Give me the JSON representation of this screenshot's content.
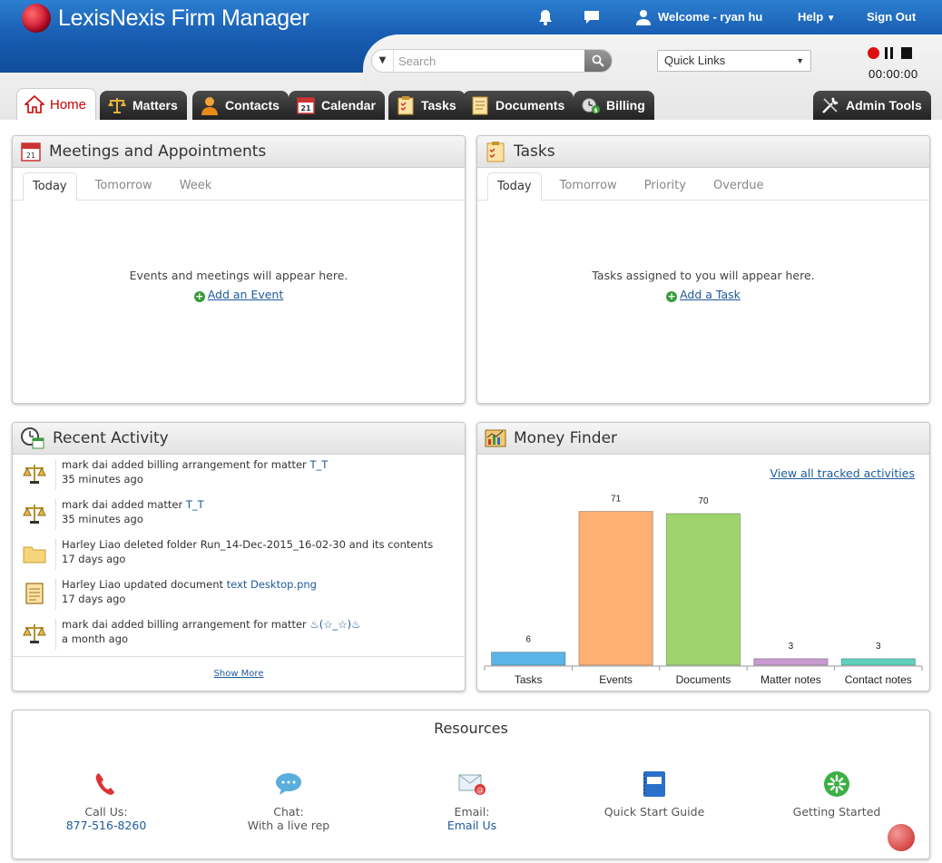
{
  "brand": {
    "name": "LexisNexis Firm Manager"
  },
  "top_nav": {
    "welcome": "Welcome - ryan hu",
    "help": "Help",
    "sign_out": "Sign Out"
  },
  "search": {
    "placeholder": "Search"
  },
  "quick_links": {
    "selected": "Quick Links"
  },
  "timer": {
    "value": "00:00:00"
  },
  "tabs": [
    {
      "label": "Home",
      "active": true
    },
    {
      "label": "Matters"
    },
    {
      "label": "Contacts"
    },
    {
      "label": "Calendar"
    },
    {
      "label": "Tasks"
    },
    {
      "label": "Documents"
    },
    {
      "label": "Billing"
    },
    {
      "label": "Admin Tools"
    }
  ],
  "meetings": {
    "title": "Meetings and Appointments",
    "tabs": [
      "Today",
      "Tomorrow",
      "Week"
    ],
    "empty_message": "Events and meetings will appear here.",
    "add_link": "Add an Event"
  },
  "tasks_panel": {
    "title": "Tasks",
    "tabs": [
      "Today",
      "Tomorrow",
      "Priority",
      "Overdue"
    ],
    "empty_message": "Tasks assigned to you will appear here.",
    "add_link": "Add a Task"
  },
  "recent_activity": {
    "title": "Recent Activity",
    "items": [
      {
        "icon": "scales-icon",
        "text": "mark dai added billing arrangement for matter ",
        "link": "T_T",
        "time": "35 minutes ago"
      },
      {
        "icon": "scales-icon",
        "text": "mark dai added matter ",
        "link": "T_T",
        "time": "35 minutes ago"
      },
      {
        "icon": "folder-icon",
        "text": "Harley Liao deleted folder Run_14-Dec-2015_16-02-30 and its contents",
        "link": "",
        "time": "17 days ago"
      },
      {
        "icon": "document-icon",
        "text": "Harley Liao updated document ",
        "link": "text Desktop.png",
        "time": "17 days ago"
      },
      {
        "icon": "scales-icon",
        "text": "mark dai added billing arrangement for matter ",
        "link": "♨(☆_☆)♨",
        "time": "a month ago"
      }
    ],
    "show_more": "Show More"
  },
  "money_finder": {
    "title": "Money Finder",
    "view_all": "View all tracked activities"
  },
  "chart_data": {
    "type": "bar",
    "categories": [
      "Tasks",
      "Events",
      "Documents",
      "Matter notes",
      "Contact notes"
    ],
    "values": [
      6,
      71,
      70,
      3,
      3
    ],
    "colors": [
      "#5ab4e8",
      "#fdb072",
      "#9fd46d",
      "#c99bd0",
      "#5fd0bf"
    ],
    "ylim": [
      0,
      75
    ]
  },
  "resources": {
    "title": "Resources",
    "items": [
      {
        "icon": "phone-icon",
        "label": "Call Us:",
        "value": "877-516-8260"
      },
      {
        "icon": "chat-bubble-icon",
        "label": "Chat:",
        "value": "With a live rep"
      },
      {
        "icon": "email-icon",
        "label": "Email:",
        "value": "Email Us"
      },
      {
        "icon": "guide-book-icon",
        "label": "Quick Start Guide",
        "value": ""
      },
      {
        "icon": "getting-started-icon",
        "label": "Getting Started",
        "value": ""
      }
    ]
  }
}
